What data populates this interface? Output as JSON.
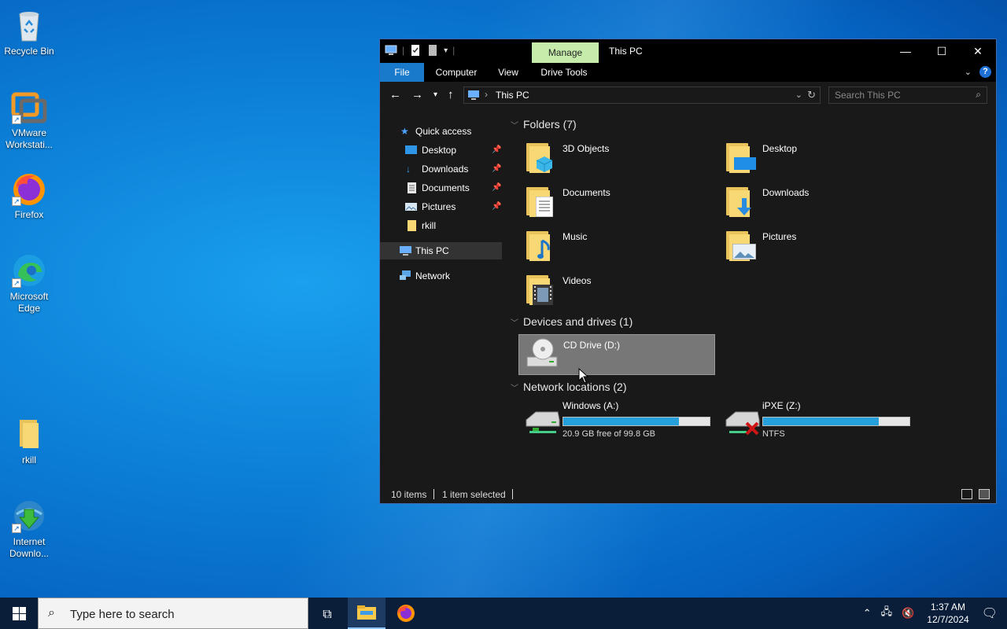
{
  "desktop": {
    "icons": [
      {
        "label": "Recycle Bin"
      },
      {
        "label": "VMware\nWorkstati..."
      },
      {
        "label": "Firefox"
      },
      {
        "label": "Microsoft\nEdge"
      },
      {
        "label": "rkill"
      },
      {
        "label": "Internet\nDownlo..."
      }
    ]
  },
  "window": {
    "contextual_tab": "Manage",
    "title": "This PC",
    "ribbon_tabs": [
      "File",
      "Computer",
      "View",
      "Drive Tools"
    ],
    "address": {
      "path": "This PC"
    },
    "search": {
      "placeholder": "Search This PC"
    },
    "nav": {
      "quick_access": "Quick access",
      "quick_items": [
        {
          "label": "Desktop",
          "icon": "desktop-icon",
          "pinned": true
        },
        {
          "label": "Downloads",
          "icon": "downloads-icon",
          "pinned": true
        },
        {
          "label": "Documents",
          "icon": "documents-icon",
          "pinned": true
        },
        {
          "label": "Pictures",
          "icon": "pictures-icon",
          "pinned": true
        },
        {
          "label": "rkill",
          "icon": "folder-icon",
          "pinned": false
        }
      ],
      "this_pc": "This PC",
      "network": "Network"
    },
    "folders_header": "Folders (7)",
    "folders": [
      "3D Objects",
      "Desktop",
      "Documents",
      "Downloads",
      "Music",
      "Pictures",
      "Videos"
    ],
    "devices_header": "Devices and drives (1)",
    "devices": [
      {
        "name": "CD Drive (D:)"
      }
    ],
    "network_header": "Network locations (2)",
    "network_locations": [
      {
        "name": "Windows (A:)",
        "detail": "20.9 GB free of 99.8 GB",
        "used_fraction": 0.79
      },
      {
        "name": "iPXE (Z:)",
        "detail": "NTFS",
        "used_fraction": 0.79
      }
    ],
    "status": {
      "items": "10 items",
      "selected": "1 item selected"
    }
  },
  "taskbar": {
    "search_placeholder": "Type here to search",
    "time": "1:37 AM",
    "date": "12/7/2024"
  },
  "colors": {
    "accent": "#1979ca",
    "manage_tab": "#c6ecac",
    "drive_bar": "#26a0da",
    "window_bg": "#191919"
  }
}
